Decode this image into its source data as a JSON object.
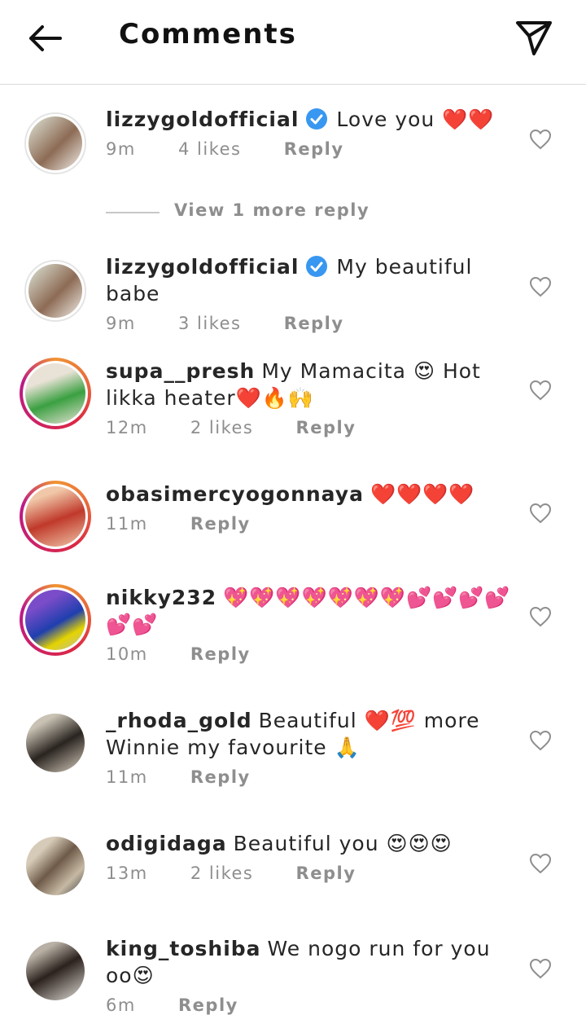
{
  "header": {
    "title": "Comments",
    "back_icon": "arrow-left-icon",
    "share_icon": "paper-plane-icon"
  },
  "comments": [
    {
      "username": "lizzygoldofficial",
      "verified": true,
      "text": "Love you ❤️❤️",
      "time": "9m",
      "likes": "4 likes",
      "reply": "Reply"
    },
    {
      "username": "lizzygoldofficial",
      "verified": true,
      "text": "My beautiful babe",
      "time": "9m",
      "likes": "3 likes",
      "reply": "Reply"
    },
    {
      "username": "supa__presh",
      "verified": false,
      "text": "My Mamacita 😍 Hot likka heater❤️🔥🙌",
      "time": "12m",
      "likes": "2 likes",
      "reply": "Reply"
    },
    {
      "username": "obasimercyogonnaya",
      "verified": false,
      "text": "❤️❤️❤️❤️",
      "time": "11m",
      "likes": "",
      "reply": "Reply"
    },
    {
      "username": "nikky232",
      "verified": false,
      "text": "💖💖💖💖💖💖💖💕💕💕💕💕💕",
      "time": "10m",
      "likes": "",
      "reply": "Reply"
    },
    {
      "username": "_rhoda_gold",
      "verified": false,
      "text": "Beautiful ❤️💯 more Winnie my favourite 🙏",
      "time": "11m",
      "likes": "",
      "reply": "Reply"
    },
    {
      "username": "odigidaga",
      "verified": false,
      "text": "Beautiful you 😍😍😍",
      "time": "13m",
      "likes": "2 likes",
      "reply": "Reply"
    },
    {
      "username": "king_toshiba",
      "verified": false,
      "text": "We nogo run for you oo😍",
      "time": "6m",
      "likes": "",
      "reply": "Reply"
    }
  ],
  "view_more_replies": "View 1 more reply",
  "colors": {
    "text": "#262626",
    "muted": "#8e8e8e",
    "verified": "#3897f0",
    "divider": "#dbdbdb"
  }
}
